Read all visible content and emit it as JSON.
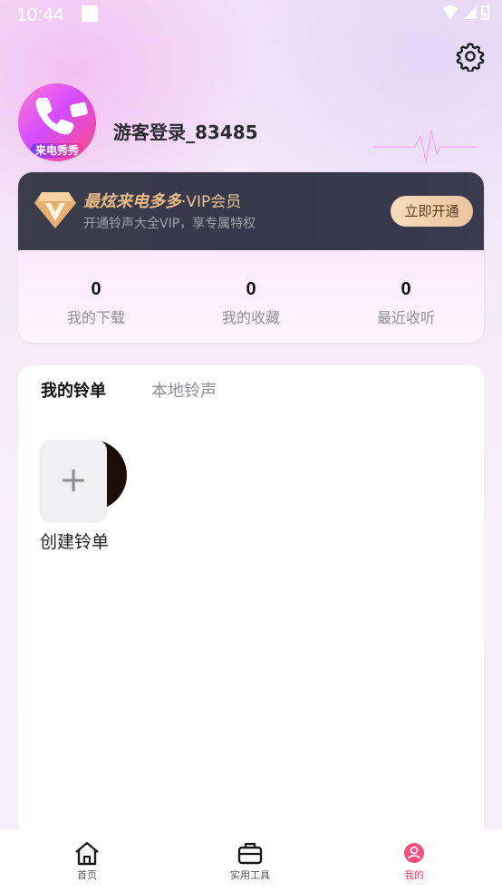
{
  "status_bar": {
    "time": "10:44"
  },
  "profile": {
    "username": "游客登录_83485",
    "avatar_caption": "来电秀秀"
  },
  "vip": {
    "title": "最炫来电多多",
    "title_suffix": "·VIP会员",
    "description": "开通铃声大全VIP，享专属特权",
    "button_label": "立即开通"
  },
  "stats": [
    {
      "value": "0",
      "label": "我的下载"
    },
    {
      "value": "0",
      "label": "我的收藏"
    },
    {
      "value": "0",
      "label": "最近收听"
    }
  ],
  "tabs": [
    {
      "label": "我的铃单",
      "active": true
    },
    {
      "label": "本地铃声",
      "active": false
    }
  ],
  "create_playlist": {
    "icon": "+",
    "label": "创建铃单"
  },
  "bottom_nav": [
    {
      "label": "首页",
      "icon": "home-icon",
      "active": false
    },
    {
      "label": "实用工具",
      "icon": "toolbox-icon",
      "active": false
    },
    {
      "label": "我的",
      "icon": "user-icon",
      "active": true
    }
  ],
  "colors": {
    "accent": "#f03e6a",
    "vip_gold": "#e8bc84",
    "vip_bg": "#3b3d4c"
  }
}
